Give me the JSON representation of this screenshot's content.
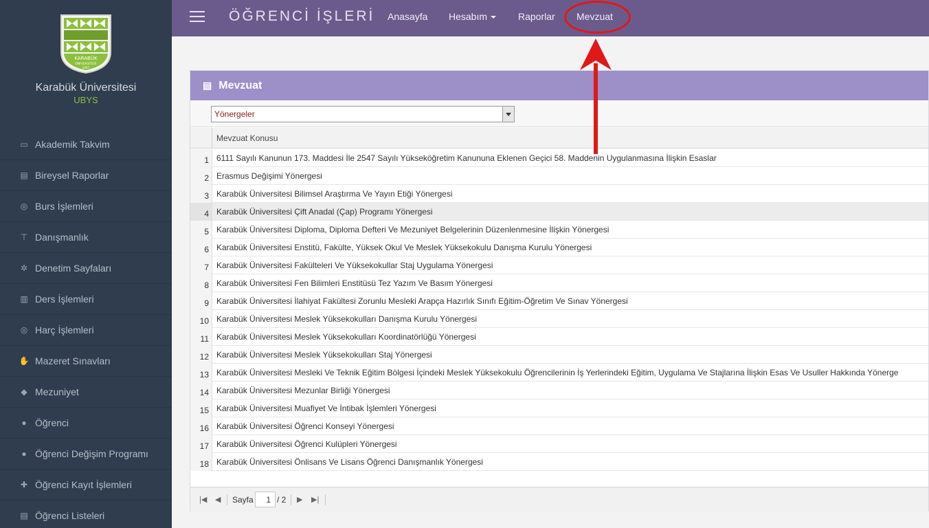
{
  "sidebar": {
    "university": "Karabük Üniversitesi",
    "system": "UBYS",
    "logo": {
      "text_top": "KARABÜK",
      "text_bottom": "ÜNİVERSİTESİ",
      "year": "2007"
    },
    "items": [
      {
        "label": "Akademik Takvim",
        "icon": "calendar-icon"
      },
      {
        "label": "Bireysel Raporlar",
        "icon": "report-icon"
      },
      {
        "label": "Burs İşlemleri",
        "icon": "coin-icon"
      },
      {
        "label": "Danışmanlık",
        "icon": "hammer-icon"
      },
      {
        "label": "Denetim Sayfaları",
        "icon": "gear-icon"
      },
      {
        "label": "Ders İşlemleri",
        "icon": "book-icon"
      },
      {
        "label": "Harç İşlemleri",
        "icon": "coin-icon"
      },
      {
        "label": "Mazeret Sınavları",
        "icon": "hand-icon"
      },
      {
        "label": "Mezuniyet",
        "icon": "graduation-cap-icon"
      },
      {
        "label": "Öğrenci",
        "icon": "users-icon"
      },
      {
        "label": "Öğrenci Değişim Programı",
        "icon": "users-icon"
      },
      {
        "label": "Öğrenci Kayıt İşlemleri",
        "icon": "user-add-icon"
      },
      {
        "label": "Öğrenci Listeleri",
        "icon": "list-icon"
      }
    ]
  },
  "topbar": {
    "title": "ÖĞRENCİ İŞLERİ",
    "nav": [
      "Anasayfa",
      "Hesabım",
      "Raporlar",
      "Mevzuat"
    ]
  },
  "panel": {
    "title": "Mevzuat",
    "select_value": "Yönergeler",
    "column_header": "Mevzuat Konusu",
    "rows": [
      {
        "n": "1",
        "text": "6111 Sayılı Kanunun 173. Maddesi İle 2547 Sayılı Yükseköğretim Kanununa Eklenen Geçici 58. Maddenin Uygulanmasına İlişkin Esaslar"
      },
      {
        "n": "2",
        "text": "Erasmus Değişimi Yönergesi"
      },
      {
        "n": "3",
        "text": "Karabük Üniversitesi Bilimsel Araştırma Ve Yayın Etiği Yönergesi"
      },
      {
        "n": "4",
        "text": "Karabük Üniversitesi Çift Anadal (Çap) Programı Yönergesi"
      },
      {
        "n": "5",
        "text": "Karabük Üniversitesi Diploma, Diploma Defteri Ve Mezuniyet Belgelerinin Düzenlenmesine İlişkin Yönergesi"
      },
      {
        "n": "6",
        "text": "Karabük Üniversitesi Enstitü, Fakülte, Yüksek Okul Ve Meslek Yüksekokulu Danışma Kurulu Yönergesi"
      },
      {
        "n": "7",
        "text": "Karabük Üniversitesi Fakülteleri Ve Yüksekokullar Staj Uygulama Yönergesi"
      },
      {
        "n": "8",
        "text": "Karabük Üniversitesi Fen Bilimleri Enstitüsü Tez Yazım Ve Basım Yönergesi"
      },
      {
        "n": "9",
        "text": "Karabük Üniversitesi İlahiyat Fakültesi Zorunlu Mesleki Arapça Hazırlık Sınıfı Eğitim-Öğretim Ve Sınav Yönergesi"
      },
      {
        "n": "10",
        "text": "Karabük Üniversitesi Meslek Yüksekokulları Danışma Kurulu Yönergesi"
      },
      {
        "n": "11",
        "text": "Karabük Üniversitesi Meslek Yüksekokulları Koordinatörlüğü Yönergesi"
      },
      {
        "n": "12",
        "text": "Karabük Üniversitesi Meslek Yüksekokulları Staj Yönergesi"
      },
      {
        "n": "13",
        "text": "Karabük Üniversitesi Mesleki Ve Teknik Eğitim Bölgesi İçindeki Meslek Yüksekokulu Öğrencilerinin İş Yerlerindeki Eğitim, Uygulama Ve Stajlarına İlişkin Esas Ve Usuller Hakkında Yönerge"
      },
      {
        "n": "14",
        "text": "Karabük Üniversitesi Mezunlar Birliği Yönergesi"
      },
      {
        "n": "15",
        "text": "Karabük Üniversitesi Muafiyet Ve İntibak İşlemleri Yönergesi"
      },
      {
        "n": "16",
        "text": "Karabük Üniversitesi Öğrenci Konseyi Yönergesi"
      },
      {
        "n": "17",
        "text": "Karabük Üniversitesi Öğrenci Kulüpleri Yönergesi"
      },
      {
        "n": "18",
        "text": "Karabük Üniversitesi Önlisans Ve Lisans Öğrenci Danışmanlık Yönergesi"
      }
    ],
    "selected_row": 4,
    "pager": {
      "label": "Sayfa",
      "current": "1",
      "total": "/ 2"
    }
  },
  "colors": {
    "topbar": "#6b5b8c",
    "sidebar": "#2f3d4e",
    "panel_header": "#9d8fc7",
    "annotation": "#e01818"
  }
}
